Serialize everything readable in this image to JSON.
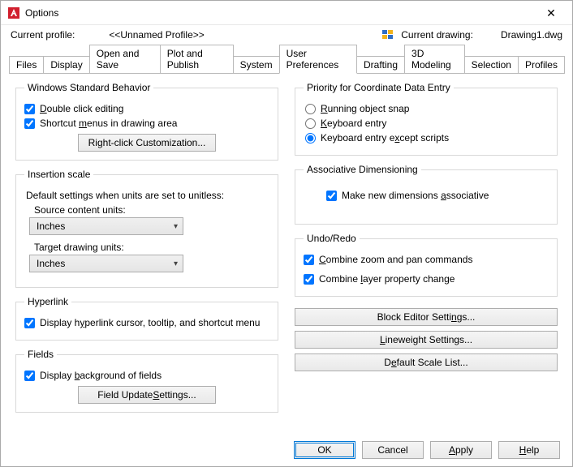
{
  "window": {
    "title": "Options",
    "close_glyph": "✕"
  },
  "header": {
    "profile_label": "Current profile:",
    "profile_value": "<<Unnamed Profile>>",
    "drawing_label": "Current drawing:",
    "drawing_value": "Drawing1.dwg"
  },
  "tabs": [
    {
      "id": "files",
      "label": "Files"
    },
    {
      "id": "display",
      "label": "Display"
    },
    {
      "id": "open_save",
      "label": "Open and Save"
    },
    {
      "id": "plot_publish",
      "label": "Plot and Publish"
    },
    {
      "id": "system",
      "label": "System"
    },
    {
      "id": "user_prefs",
      "label": "User Preferences",
      "active": true
    },
    {
      "id": "drafting",
      "label": "Drafting"
    },
    {
      "id": "modeling",
      "label": "3D Modeling"
    },
    {
      "id": "selection",
      "label": "Selection"
    },
    {
      "id": "profiles",
      "label": "Profiles"
    }
  ],
  "left": {
    "wsb": {
      "legend": "Windows Standard Behavior",
      "dbl_click": "Double click editing",
      "shortcut": "Shortcut menus in drawing area",
      "btn": "Right-click Customization..."
    },
    "ins": {
      "legend": "Insertion scale",
      "desc": "Default settings when units are set to unitless:",
      "src_label": "Source content units:",
      "src_value": "Inches",
      "tgt_label": "Target drawing units:",
      "tgt_value": "Inches"
    },
    "hyper": {
      "legend": "Hyperlink",
      "chk": "Display hyperlink cursor, tooltip, and shortcut menu"
    },
    "fields": {
      "legend": "Fields",
      "chk": "Display background of fields",
      "btn": "Field Update Settings..."
    }
  },
  "right": {
    "prio": {
      "legend": "Priority for Coordinate Data Entry",
      "r1": "Running object snap",
      "r2": "Keyboard entry",
      "r3": "Keyboard entry except scripts"
    },
    "assoc": {
      "legend": "Associative Dimensioning",
      "chk": "Make new dimensions associative"
    },
    "undo": {
      "legend": "Undo/Redo",
      "c1": "Combine zoom and pan commands",
      "c2": "Combine layer property change"
    },
    "buttons": {
      "b1": "Block Editor Settings...",
      "b2": "Lineweight Settings...",
      "b3": "Default Scale List..."
    }
  },
  "footer": {
    "ok": "OK",
    "cancel": "Cancel",
    "apply": "Apply",
    "help": "Help"
  }
}
